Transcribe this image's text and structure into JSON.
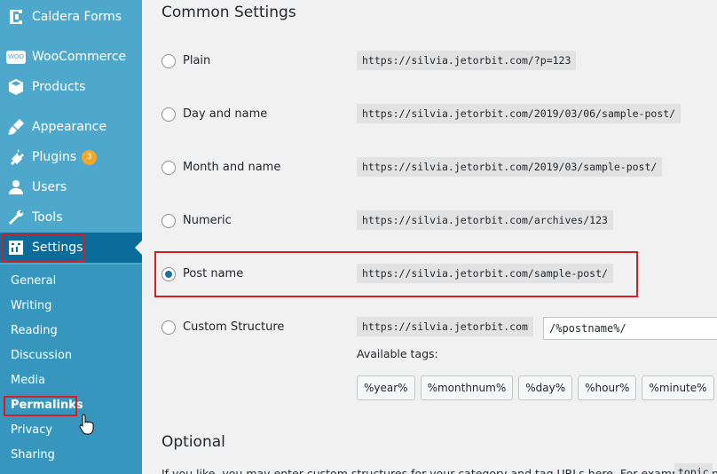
{
  "sidebar": {
    "menu": [
      {
        "label": "Caldera Forms",
        "icon": "caldera-forms-icon"
      },
      {
        "label": "WooCommerce",
        "icon": "woocommerce-icon"
      },
      {
        "label": "Products",
        "icon": "products-icon"
      },
      {
        "label": "Appearance",
        "icon": "appearance-icon"
      },
      {
        "label": "Plugins",
        "icon": "plugins-icon",
        "badge": "3"
      },
      {
        "label": "Users",
        "icon": "users-icon"
      },
      {
        "label": "Tools",
        "icon": "tools-icon"
      },
      {
        "label": "Settings",
        "icon": "settings-icon"
      }
    ],
    "submenu": [
      "General",
      "Writing",
      "Reading",
      "Discussion",
      "Media",
      "Permalinks",
      "Privacy",
      "Sharing"
    ],
    "woo_badge": "WOO"
  },
  "common": {
    "title": "Common Settings",
    "options": [
      {
        "label": "Plain",
        "url": "https://silvia.jetorbit.com/?p=123"
      },
      {
        "label": "Day and name",
        "url": "https://silvia.jetorbit.com/2019/03/06/sample-post/"
      },
      {
        "label": "Month and name",
        "url": "https://silvia.jetorbit.com/2019/03/sample-post/"
      },
      {
        "label": "Numeric",
        "url": "https://silvia.jetorbit.com/archives/123"
      },
      {
        "label": "Post name",
        "url": "https://silvia.jetorbit.com/sample-post/"
      },
      {
        "label": "Custom Structure",
        "url": "https://silvia.jetorbit.com"
      }
    ],
    "custom_value": "/%postname%/",
    "available_tags_label": "Available tags:",
    "tags": [
      "%year%",
      "%monthnum%",
      "%day%",
      "%hour%",
      "%minute%"
    ]
  },
  "optional": {
    "title": "Optional",
    "help_text": "If you like, you may enter custom structures for your category and tag URLs here. For example, using",
    "help_code": "topic"
  },
  "colors": {
    "sidebar": "#4ea8cc",
    "active": "#0a6c9a",
    "highlight": "#d31f26"
  }
}
